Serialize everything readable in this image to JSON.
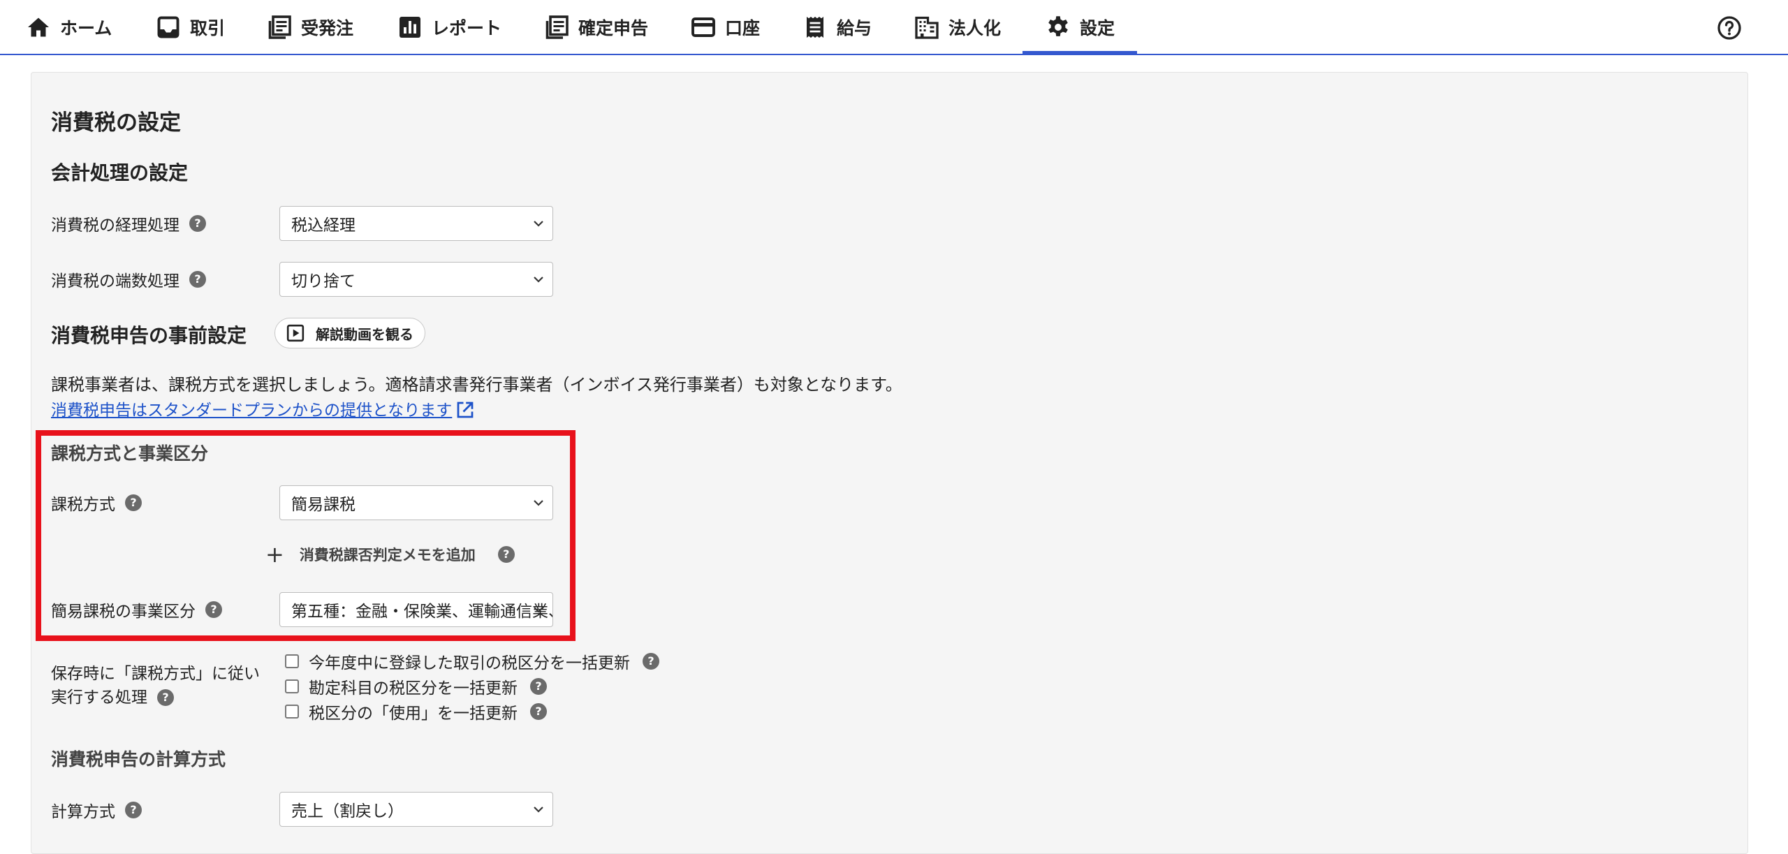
{
  "nav": {
    "items": [
      {
        "label": "ホーム",
        "icon": "home-icon"
      },
      {
        "label": "取引",
        "icon": "inbox-icon"
      },
      {
        "label": "受発注",
        "icon": "document-list-icon"
      },
      {
        "label": "レポート",
        "icon": "bar-chart-icon"
      },
      {
        "label": "確定申告",
        "icon": "document-list-icon"
      },
      {
        "label": "口座",
        "icon": "credit-card-icon"
      },
      {
        "label": "給与",
        "icon": "receipt-icon"
      },
      {
        "label": "法人化",
        "icon": "building-icon"
      },
      {
        "label": "設定",
        "icon": "gear-icon",
        "active": true
      }
    ],
    "accent_color": "#3458cf"
  },
  "page": {
    "title": "消費税の設定",
    "accounting": {
      "heading": "会計処理の設定",
      "method_label": "消費税の経理処理",
      "method_value": "税込経理",
      "rounding_label": "消費税の端数処理",
      "rounding_value": "切り捨て"
    },
    "pre_filing": {
      "heading": "消費税申告の事前設定",
      "video_button": "解説動画を観る",
      "description": "課税事業者は、課税方式を選択しましょう。適格請求書発行事業者（インボイス発行事業者）も対象となります。",
      "plan_link": "消費税申告はスタンダードプランからの提供となります"
    },
    "taxation": {
      "heading": "課税方式と事業区分",
      "method_label": "課税方式",
      "method_value": "簡易課税",
      "memo_button": "消費税課否判定メモを追加",
      "business_label": "簡易課税の事業区分",
      "business_value": "第五種：金融・保険業、運輸通信業、サービス業",
      "highlight_color": "#e8111b"
    },
    "on_save": {
      "label_line1": "保存時に「課税方式」に従い",
      "label_line2": "実行する処理",
      "options": [
        {
          "label": "今年度中に登録した取引の税区分を一括更新",
          "checked": false
        },
        {
          "label": "勘定科目の税区分を一括更新",
          "checked": false
        },
        {
          "label": "税区分の「使用」を一括更新",
          "checked": false
        }
      ]
    },
    "calculation": {
      "heading": "消費税申告の計算方式",
      "method_label": "計算方式",
      "method_value": "売上（割戻し）"
    }
  }
}
